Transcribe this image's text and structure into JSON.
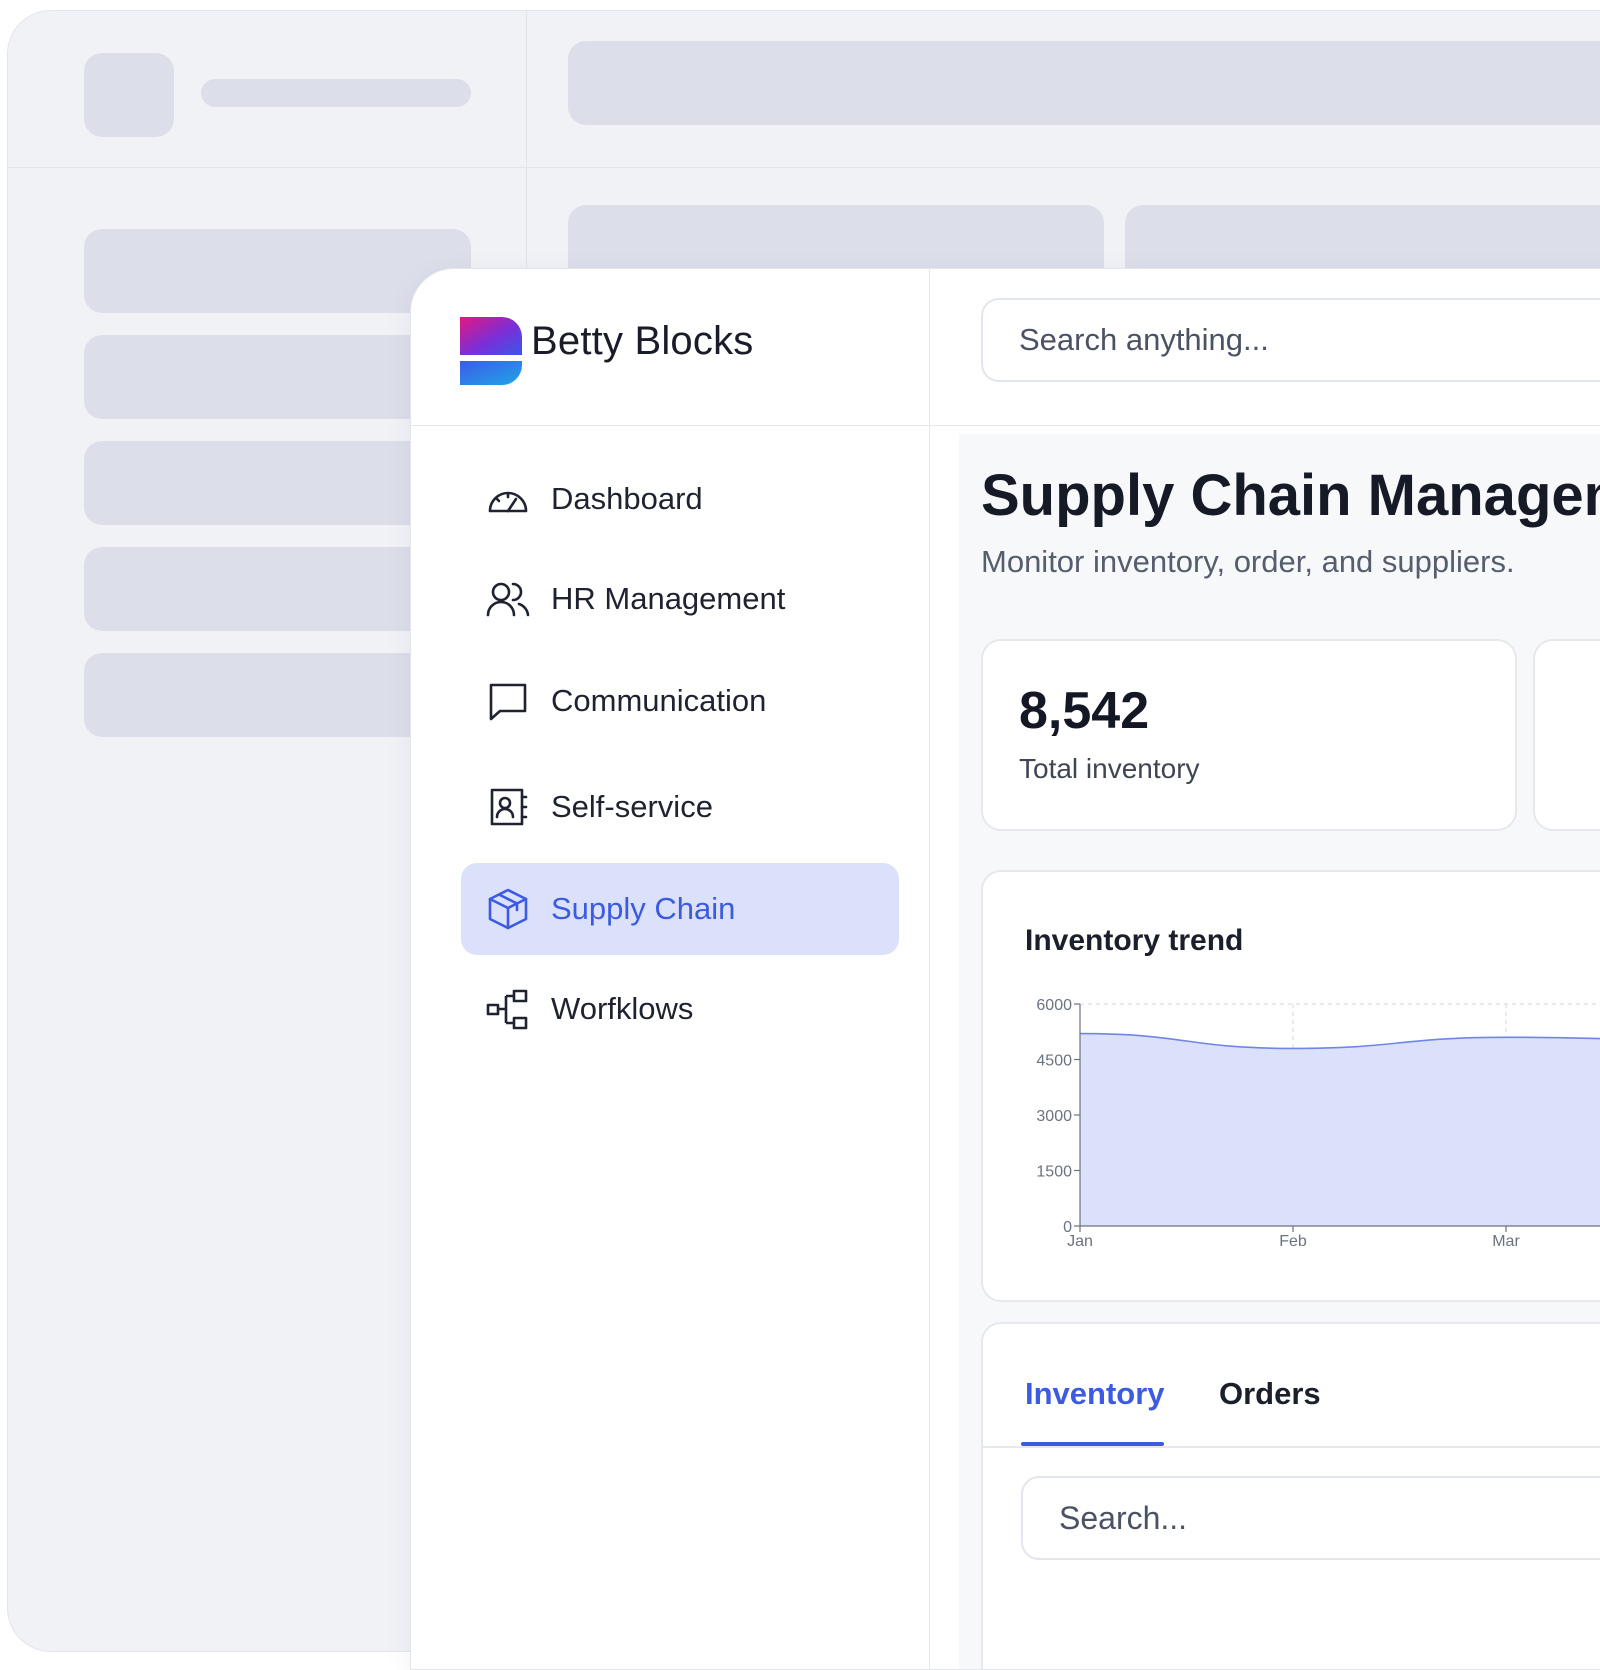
{
  "brand": {
    "name": "Betty Blocks"
  },
  "search": {
    "placeholder": "Search anything..."
  },
  "sidebar": {
    "items": [
      {
        "label": "Dashboard",
        "icon": "gauge-icon",
        "active": false
      },
      {
        "label": "HR Management",
        "icon": "users-icon",
        "active": false
      },
      {
        "label": "Communication",
        "icon": "message-icon",
        "active": false
      },
      {
        "label": "Self-service",
        "icon": "contact-book-icon",
        "active": false
      },
      {
        "label": "Supply Chain",
        "icon": "package-icon",
        "active": true
      },
      {
        "label": "Worfklows",
        "icon": "workflow-icon",
        "active": false
      }
    ]
  },
  "page": {
    "title": "Supply Chain Management",
    "subtitle": "Monitor inventory, order, and suppliers."
  },
  "stats": [
    {
      "value": "8,542",
      "label": "Total inventory"
    }
  ],
  "chart_data": {
    "type": "area",
    "title": "Inventory trend",
    "x": [
      "Jan",
      "Feb",
      "Mar"
    ],
    "values": [
      5200,
      4800,
      5100
    ],
    "yticks": [
      0,
      1500,
      3000,
      4500,
      6000
    ],
    "ylim": [
      0,
      6000
    ],
    "grid": true,
    "color": "#6f86e8",
    "fill": "#dbe1fb"
  },
  "tabs": [
    {
      "label": "Inventory",
      "active": true
    },
    {
      "label": "Orders",
      "active": false
    }
  ],
  "table": {
    "search_placeholder": "Search..."
  },
  "colors": {
    "accent": "#3d5be0",
    "active_bg": "#dbe1fb",
    "skeleton": "#dcdfea",
    "background": "#f1f2f6"
  }
}
